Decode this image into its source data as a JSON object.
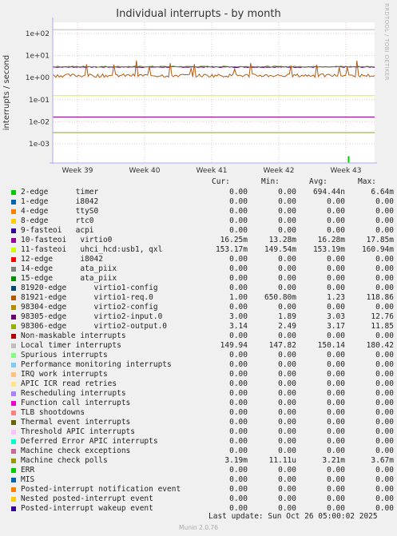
{
  "chart_data": {
    "type": "line",
    "title": "Individual interrupts - by month",
    "ylabel": "interrupts / second",
    "yscale": "log",
    "ylim": [
      0.0003,
      200
    ],
    "y_ticks": [
      "1e+02",
      "1e+01",
      "1e+00",
      "1e-01",
      "1e-02",
      "1e-03"
    ],
    "y_tick_values": [
      100,
      10,
      1,
      0.1,
      0.01,
      0.001
    ],
    "x_ticks": [
      "Week 39",
      "Week 40",
      "Week 41",
      "Week 42",
      "Week 43"
    ],
    "series_plotted": [
      {
        "name": "Local timer interrupts",
        "level": 150,
        "color": "#bbbbbb"
      },
      {
        "name": "11-fasteoi",
        "level": 0.153,
        "color": "#ccff00"
      },
      {
        "name": "10-fasteoi",
        "level": 0.0163,
        "color": "#990099"
      },
      {
        "name": "98305-edge",
        "level": 3.03,
        "color": "#550077"
      },
      {
        "name": "98306-edge",
        "level": 3.17,
        "color": "#668822"
      },
      {
        "name": "Machine check polls",
        "level": 0.00321,
        "color": "#88aa22"
      },
      {
        "name": "81921-edge",
        "level": 1.23,
        "color": "#b05a10"
      },
      {
        "name": "2-edge",
        "level": 0.000694,
        "color": "#00cc00"
      }
    ]
  },
  "side_label": "RRDTOOL / TOBI OETIKER",
  "headers": {
    "cur": "Cur:",
    "min": "Min:",
    "avg": "Avg:",
    "max": "Max:"
  },
  "rows": [
    {
      "label": "2-edge      timer",
      "color": "#00cc00",
      "cur": "0.00",
      "min": "0.00",
      "avg": "694.44n",
      "max": "6.64m"
    },
    {
      "label": "1-edge      i8042",
      "color": "#0066b3",
      "cur": "0.00",
      "min": "0.00",
      "avg": "0.00",
      "max": "0.00"
    },
    {
      "label": "4-edge      ttyS0",
      "color": "#ff8000",
      "cur": "0.00",
      "min": "0.00",
      "avg": "0.00",
      "max": "0.00"
    },
    {
      "label": "8-edge      rtc0",
      "color": "#ffcc00",
      "cur": "0.00",
      "min": "0.00",
      "avg": "0.00",
      "max": "0.00"
    },
    {
      "label": "9-fasteoi   acpi",
      "color": "#330099",
      "cur": "0.00",
      "min": "0.00",
      "avg": "0.00",
      "max": "0.00"
    },
    {
      "label": "10-fasteoi   virtio0",
      "color": "#990099",
      "cur": "16.25m",
      "min": "13.28m",
      "avg": "16.28m",
      "max": "17.85m"
    },
    {
      "label": "11-fasteoi   uhci_hcd:usb1, qxl",
      "color": "#ccff00",
      "cur": "153.17m",
      "min": "149.54m",
      "avg": "153.19m",
      "max": "160.94m"
    },
    {
      "label": "12-edge      i8042",
      "color": "#ff0000",
      "cur": "0.00",
      "min": "0.00",
      "avg": "0.00",
      "max": "0.00"
    },
    {
      "label": "14-edge      ata_piix",
      "color": "#808080",
      "cur": "0.00",
      "min": "0.00",
      "avg": "0.00",
      "max": "0.00"
    },
    {
      "label": "15-edge      ata_piix",
      "color": "#008f00",
      "cur": "0.00",
      "min": "0.00",
      "avg": "0.00",
      "max": "0.00"
    },
    {
      "label": "81920-edge      virtio1-config",
      "color": "#00487d",
      "cur": "0.00",
      "min": "0.00",
      "avg": "0.00",
      "max": "0.00"
    },
    {
      "label": "81921-edge      virtio1-req.0",
      "color": "#b35a00",
      "cur": "1.00",
      "min": "650.80m",
      "avg": "1.23",
      "max": "118.86"
    },
    {
      "label": "98304-edge      virtio2-config",
      "color": "#b38f00",
      "cur": "0.00",
      "min": "0.00",
      "avg": "0.00",
      "max": "0.00"
    },
    {
      "label": "98305-edge      virtio2-input.0",
      "color": "#6b006b",
      "cur": "3.00",
      "min": "1.89",
      "avg": "3.03",
      "max": "12.76"
    },
    {
      "label": "98306-edge      virtio2-output.0",
      "color": "#8fb300",
      "cur": "3.14",
      "min": "2.49",
      "avg": "3.17",
      "max": "11.85"
    },
    {
      "label": "Non-maskable interrupts",
      "color": "#b30000",
      "cur": "0.00",
      "min": "0.00",
      "avg": "0.00",
      "max": "0.00"
    },
    {
      "label": "Local timer interrupts",
      "color": "#bebebe",
      "cur": "149.94",
      "min": "147.82",
      "avg": "150.14",
      "max": "180.42"
    },
    {
      "label": "Spurious interrupts",
      "color": "#80ff80",
      "cur": "0.00",
      "min": "0.00",
      "avg": "0.00",
      "max": "0.00"
    },
    {
      "label": "Performance monitoring interrupts",
      "color": "#80c9ff",
      "cur": "0.00",
      "min": "0.00",
      "avg": "0.00",
      "max": "0.00"
    },
    {
      "label": "IRQ work interrupts",
      "color": "#ffc080",
      "cur": "0.00",
      "min": "0.00",
      "avg": "0.00",
      "max": "0.00"
    },
    {
      "label": "APIC ICR read retries",
      "color": "#ffe680",
      "cur": "0.00",
      "min": "0.00",
      "avg": "0.00",
      "max": "0.00"
    },
    {
      "label": "Rescheduling interrupts",
      "color": "#aa80ff",
      "cur": "0.00",
      "min": "0.00",
      "avg": "0.00",
      "max": "0.00"
    },
    {
      "label": "Function call interrupts",
      "color": "#ee00cc",
      "cur": "0.00",
      "min": "0.00",
      "avg": "0.00",
      "max": "0.00"
    },
    {
      "label": "TLB shootdowns",
      "color": "#ff8080",
      "cur": "0.00",
      "min": "0.00",
      "avg": "0.00",
      "max": "0.00"
    },
    {
      "label": "Thermal event interrupts",
      "color": "#666600",
      "cur": "0.00",
      "min": "0.00",
      "avg": "0.00",
      "max": "0.00"
    },
    {
      "label": "Threshold APIC interrupts",
      "color": "#ffbfff",
      "cur": "0.00",
      "min": "0.00",
      "avg": "0.00",
      "max": "0.00"
    },
    {
      "label": "Deferred Error APIC interrupts",
      "color": "#00ffcc",
      "cur": "0.00",
      "min": "0.00",
      "avg": "0.00",
      "max": "0.00"
    },
    {
      "label": "Machine check exceptions",
      "color": "#cc6699",
      "cur": "0.00",
      "min": "0.00",
      "avg": "0.00",
      "max": "0.00"
    },
    {
      "label": "Machine check polls",
      "color": "#999900",
      "cur": "3.19m",
      "min": "11.11u",
      "avg": "3.21m",
      "max": "3.67m"
    },
    {
      "label": "ERR",
      "color": "#00cc00",
      "cur": "0.00",
      "min": "0.00",
      "avg": "0.00",
      "max": "0.00"
    },
    {
      "label": "MIS",
      "color": "#0066b3",
      "cur": "0.00",
      "min": "0.00",
      "avg": "0.00",
      "max": "0.00"
    },
    {
      "label": "Posted-interrupt notification event",
      "color": "#ff8000",
      "cur": "0.00",
      "min": "0.00",
      "avg": "0.00",
      "max": "0.00"
    },
    {
      "label": "Nested posted-interrupt event",
      "color": "#ffcc00",
      "cur": "0.00",
      "min": "0.00",
      "avg": "0.00",
      "max": "0.00"
    },
    {
      "label": "Posted-interrupt wakeup event",
      "color": "#330099",
      "cur": "0.00",
      "min": "0.00",
      "avg": "0.00",
      "max": "0.00"
    }
  ],
  "footer": "Last update: Sun Oct 26 05:00:02 2025",
  "munin": "Munin 2.0.76"
}
